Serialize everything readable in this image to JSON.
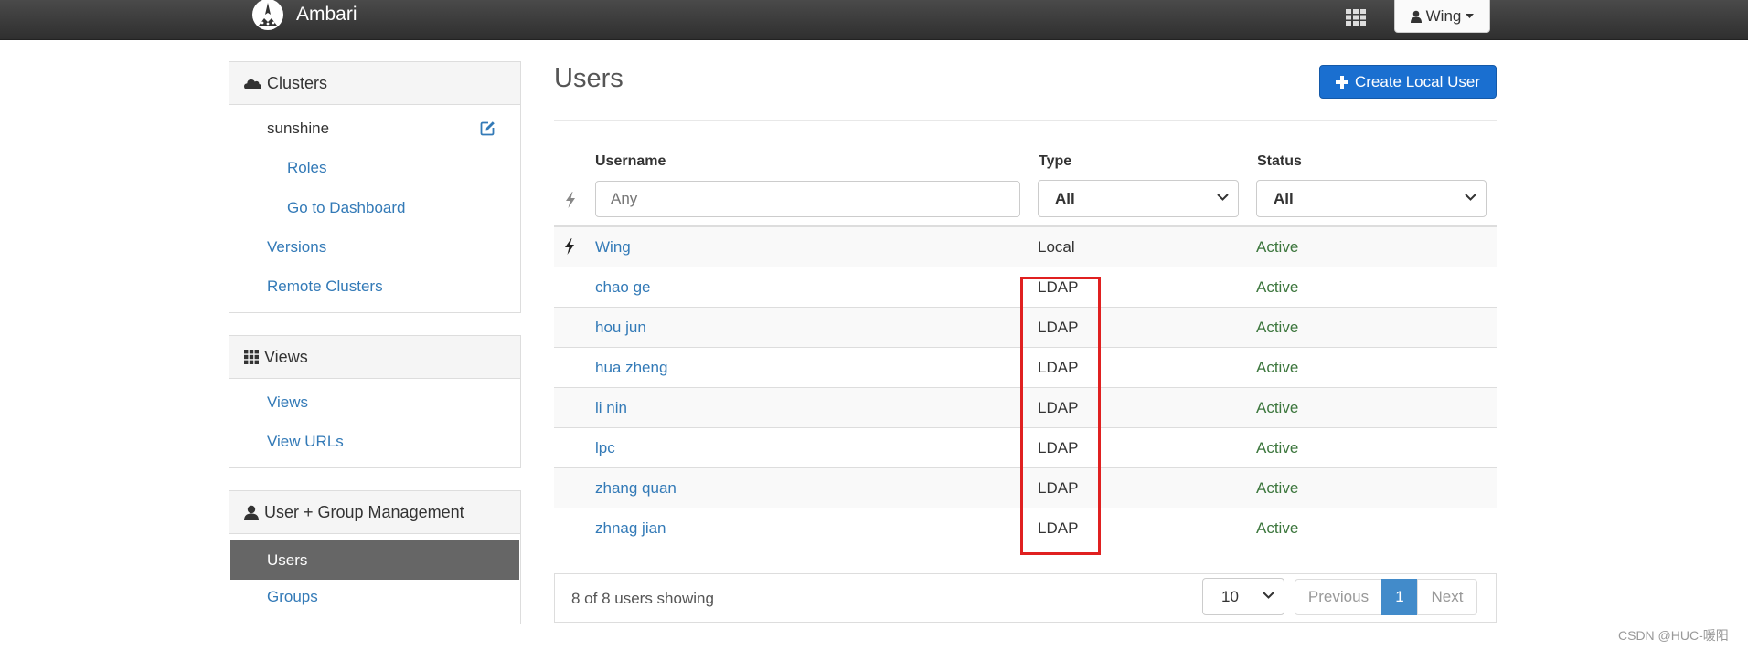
{
  "app": {
    "title": "Ambari",
    "user_menu_label": "Wing"
  },
  "sidebar": {
    "clusters": {
      "heading": "Clusters",
      "cluster_name": "sunshine",
      "items": [
        "Roles",
        "Go to Dashboard",
        "Versions",
        "Remote Clusters"
      ]
    },
    "views": {
      "heading": "Views",
      "items": [
        "Views",
        "View URLs"
      ]
    },
    "user_group": {
      "heading": "User + Group Management",
      "items": [
        "Users",
        "Groups"
      ],
      "active": "Users"
    }
  },
  "main": {
    "title": "Users",
    "create_button": "Create Local User",
    "columns": [
      "Username",
      "Type",
      "Status"
    ],
    "filters": {
      "username_placeholder": "Any",
      "type_value": "All",
      "status_value": "All"
    },
    "rows": [
      {
        "username": "Wing",
        "type": "Local",
        "status": "Active",
        "admin": true
      },
      {
        "username": "chao ge",
        "type": "LDAP",
        "status": "Active"
      },
      {
        "username": "hou jun",
        "type": "LDAP",
        "status": "Active"
      },
      {
        "username": "hua zheng",
        "type": "LDAP",
        "status": "Active"
      },
      {
        "username": "li nin",
        "type": "LDAP",
        "status": "Active"
      },
      {
        "username": "lpc",
        "type": "LDAP",
        "status": "Active"
      },
      {
        "username": "zhang quan",
        "type": "LDAP",
        "status": "Active"
      },
      {
        "username": "zhnag jian",
        "type": "LDAP",
        "status": "Active"
      }
    ],
    "footer": {
      "count_text": "8 of 8 users showing",
      "page_size": "10",
      "prev_label": "Previous",
      "current_page": "1",
      "next_label": "Next"
    }
  },
  "watermark": "CSDN @HUC-暖阳",
  "colors": {
    "link": "#337ab7",
    "status_active": "#3c763d",
    "primary_button": "#1a6fd0",
    "highlight_box": "#e02020"
  }
}
